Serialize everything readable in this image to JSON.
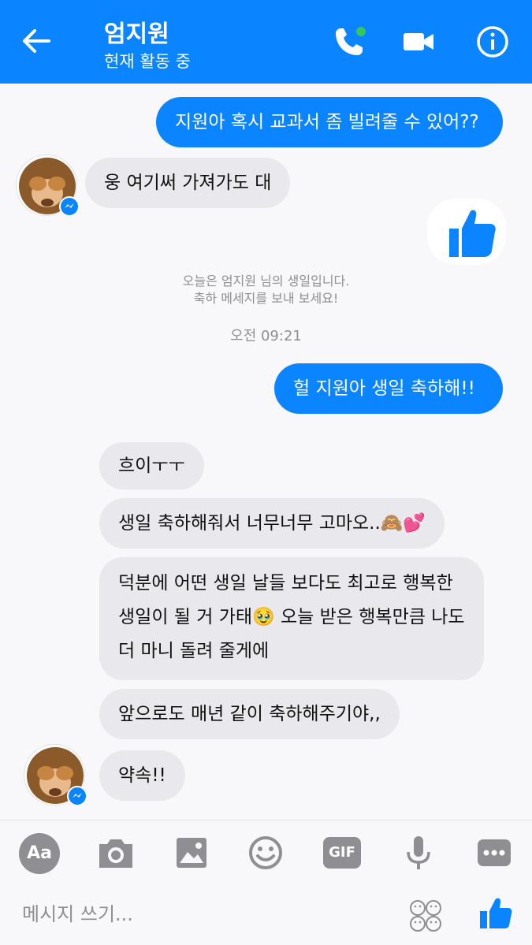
{
  "header": {
    "title": "엄지원",
    "status": "현재 활동 중"
  },
  "messages": {
    "m1": "지원아 혹시 교과서 좀 빌려줄 수 있어??",
    "m2": "웅 여기써 가져가도 대",
    "notice_line1": "오늘은 엄지원 님의 생일입니다.",
    "notice_line2": "축하 메세지를 보내 보세요!",
    "timestamp": "오전 09:21",
    "m3": "헐 지원아 생일 축하해!!",
    "m4": "흐이ㅜㅜ",
    "m5": "생일 축하해줘서 너무너무 고마오..🙈💕",
    "m6_line1": "덕분에 어떤 생일 날들 보다도 최고로 행복한",
    "m6_line2": "생일이 될 거 가태🥹 오늘 받은 행복만큼 나도",
    "m6_line3": "더 마니 돌려 줄게에",
    "m7": "앞으로도 매년 같이 축하해주기야,,",
    "m8": "약속!!"
  },
  "toolbar": {
    "aa_label": "Aa",
    "gif_label": "GIF"
  },
  "composer": {
    "placeholder": "메시지 쓰기..."
  },
  "colors": {
    "brand": "#0a84ff",
    "incoming_bubble": "#e9e9ed",
    "icon_gray": "#8e8e93",
    "online_dot": "#34c759"
  }
}
